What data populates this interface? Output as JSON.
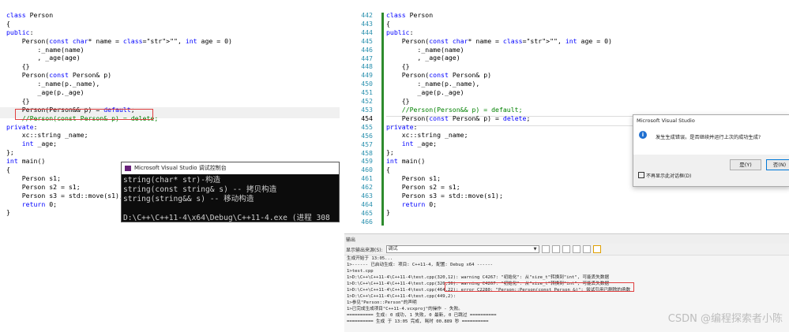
{
  "left_code": [
    {
      "t": "class Person"
    },
    {
      "t": "{"
    },
    {
      "t": "public:"
    },
    {
      "t": "    Person(const char* name = \"\", int age = 0)"
    },
    {
      "t": "        :_name(name)"
    },
    {
      "t": "        , _age(age)"
    },
    {
      "t": "    {}"
    },
    {
      "t": "    Person(const Person& p)"
    },
    {
      "t": "        :_name(p._name),"
    },
    {
      "t": "        _age(p._age)"
    },
    {
      "t": "    {}"
    },
    {
      "t": "    Person(Person&& p) = default;"
    },
    {
      "t": "    //Person(const Person& p) = delete;"
    },
    {
      "t": "private:"
    },
    {
      "t": "    xc::string _name;"
    },
    {
      "t": "    int _age;"
    },
    {
      "t": "};"
    },
    {
      "t": "int main()"
    },
    {
      "t": "{"
    },
    {
      "t": "    Person s1;"
    },
    {
      "t": "    Person s2 = s1;"
    },
    {
      "t": "    Person s3 = std::move(s1);"
    },
    {
      "t": "    return 0;"
    },
    {
      "t": "}"
    }
  ],
  "console": {
    "title": "Microsoft Visual Studio 调试控制台",
    "lines": [
      "string(char* str)-构造",
      "string(const string& s) -- 拷贝构造",
      "string(string&& s) -- 移动构造",
      "",
      "D:\\C++\\C++11-4\\x64\\Debug\\C++11-4.exe (进程 308"
    ]
  },
  "right_line_numbers": [
    "442",
    "443",
    "444",
    "445",
    "446",
    "447",
    "448",
    "449",
    "450",
    "451",
    "452",
    "453",
    "454",
    "455",
    "456",
    "457",
    "458",
    "459",
    "460",
    "461",
    "462",
    "463",
    "464",
    "465",
    "466"
  ],
  "right_current_line": "454",
  "right_code": [
    {
      "t": "class Person"
    },
    {
      "t": "{"
    },
    {
      "t": "public:"
    },
    {
      "t": "    Person(const char* name = \"\", int age = 0)"
    },
    {
      "t": "        :_name(name)"
    },
    {
      "t": "        , _age(age)"
    },
    {
      "t": "    {}"
    },
    {
      "t": "    Person(const Person& p)"
    },
    {
      "t": "        :_name(p._name),"
    },
    {
      "t": "        _age(p._age)"
    },
    {
      "t": "    {}"
    },
    {
      "t": "    //Person(Person&& p) = default;"
    },
    {
      "t": "    Person(const Person& p) = delete;"
    },
    {
      "t": "private:"
    },
    {
      "t": "    xc::string _name;"
    },
    {
      "t": "    int _age;"
    },
    {
      "t": "};"
    },
    {
      "t": "int main()"
    },
    {
      "t": "{"
    },
    {
      "t": "    Person s1;"
    },
    {
      "t": "    Person s2 = s1;"
    },
    {
      "t": "    Person s3 = std::move(s1);"
    },
    {
      "t": "    return 0;"
    },
    {
      "t": "}"
    },
    {
      "t": ""
    }
  ],
  "dialog": {
    "title": "Microsoft Visual Studio",
    "message": "发生生成错误。是否继续并运行上次的成功生成?",
    "yes": "是(Y)",
    "no": "否(N)",
    "checkbox": "不再显示此对话框(D)"
  },
  "output": {
    "title": "输出",
    "source_label": "显示输出来源(S):",
    "source_value": "调试",
    "lines": [
      "生成开始于 13:05...",
      "1>------ 已启动生成: 项目: C++11-4, 配置: Debug x64 ------",
      "1>test.cpp",
      "1>D:\\C++\\C++11-4\\C++11-4\\test.cpp(320,12): warning C4267: \"初始化\": 从\"size_t\"转换到\"int\", 可能丢失数据",
      "1>D:\\C++\\C++11-4\\C++11-4\\test.cpp(320,36): warning C4267: \"初始化\": 从\"size_t\"转换到\"int\", 可能丢失数据",
      "1>D:\\C++\\C++11-4\\C++11-4\\test.cpp(464,22): error C2280: \"Person::Person(const Person &)\": 尝试引用已删除的函数",
      "1>D:\\C++\\C++11-4\\C++11-4\\test.cpp(449,2):",
      "1>参见\"Person::Person\"的声明",
      "1>已完成生成项目\"C++11-4.vcxproj\"的操作 - 失败。",
      "========== 生成: 0 成功, 1 失败, 0 最新, 0 已跳过 ==========",
      "========== 生成 于 13:05 完成, 耗时 00.889 秒 =========="
    ]
  },
  "watermark": "CSDN @编程探索者小陈"
}
